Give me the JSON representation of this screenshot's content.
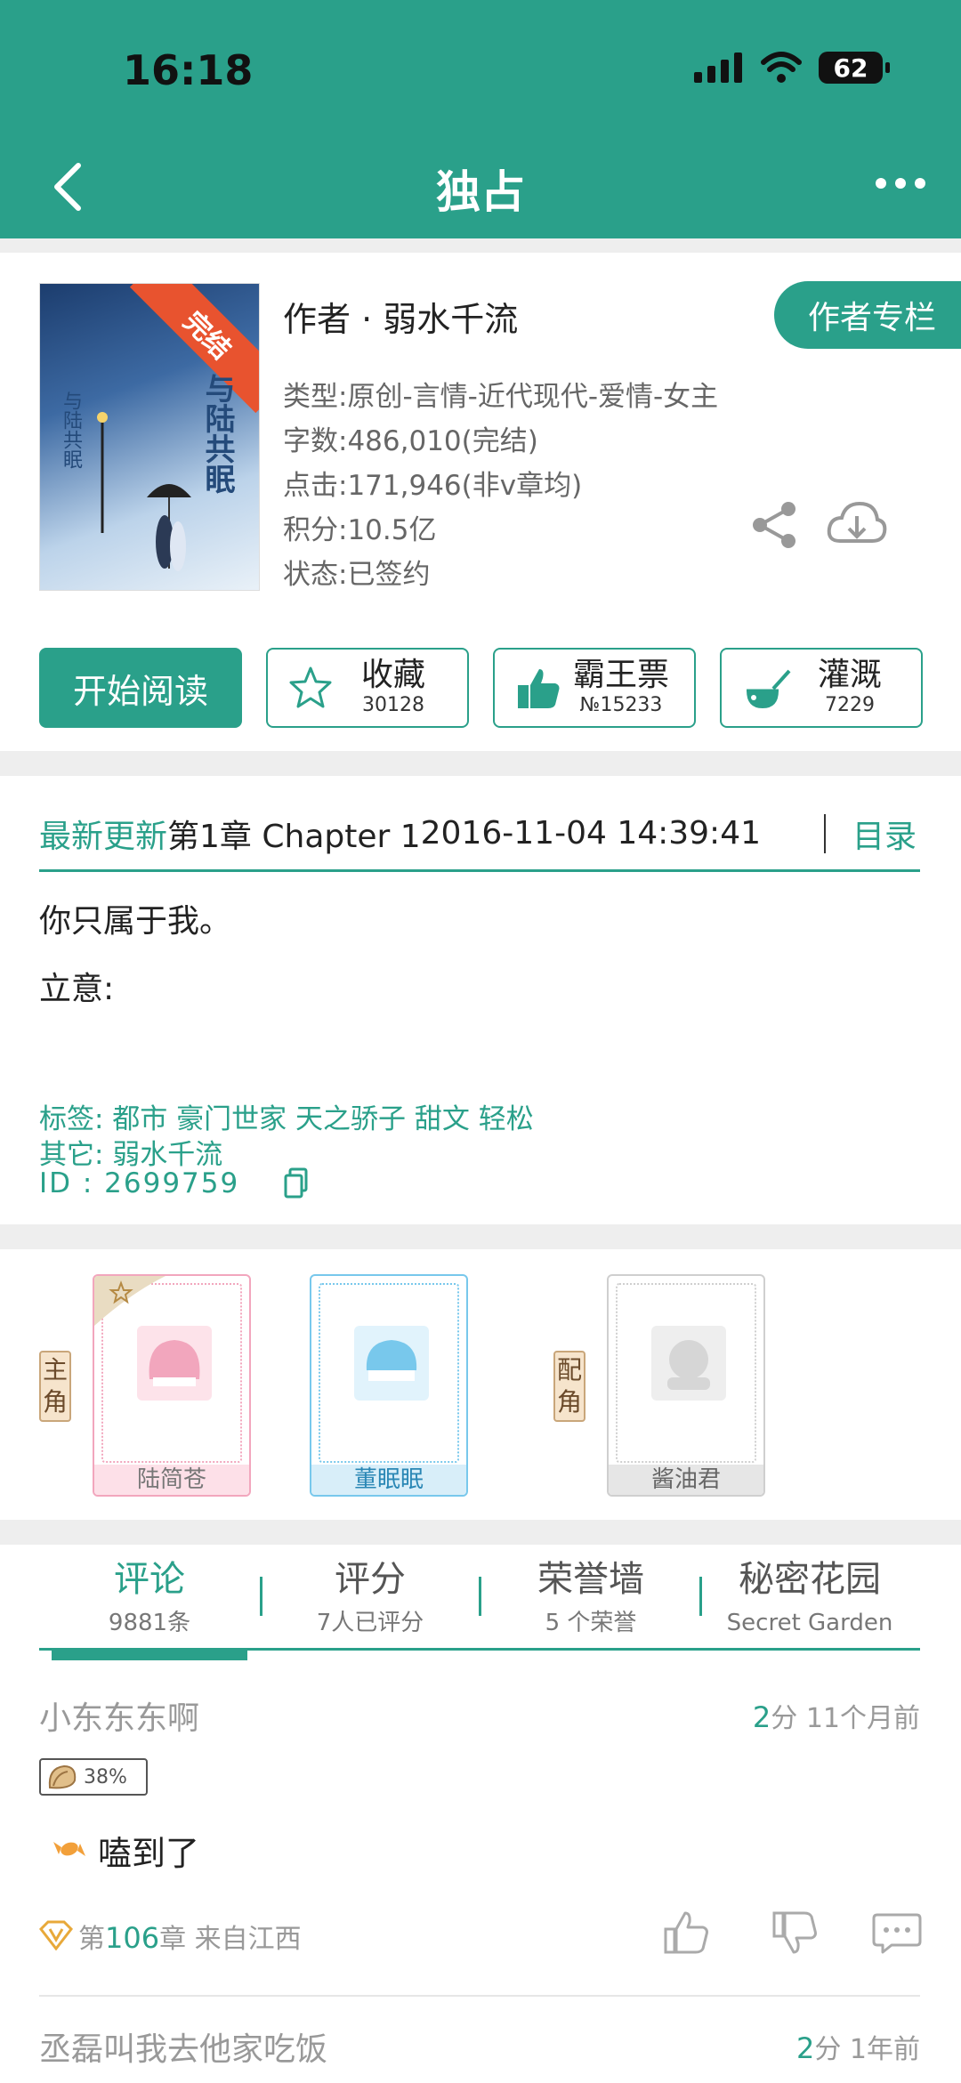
{
  "status_bar": {
    "time": "16:18",
    "battery": "62"
  },
  "nav": {
    "title": "独占"
  },
  "book": {
    "ribbon": "完结",
    "cover_title": "与陆共眠",
    "author": "作者 · 弱水千流",
    "author_column_label": "作者专栏",
    "genre": "类型:原创-言情-近代现代-爱情-女主",
    "words": "字数:486,010(完结)",
    "clicks": "点击:171,946(非v章均)",
    "points": "积分:10.5亿",
    "status": "状态:已签约"
  },
  "actions": {
    "read_label": "开始阅读",
    "collect": {
      "label": "收藏",
      "count": "30128"
    },
    "vote": {
      "label": "霸王票",
      "count": "№15233"
    },
    "water": {
      "label": "灌溉",
      "count": "7229"
    }
  },
  "update": {
    "label": "最新更新",
    "chapter": "第1章 Chapter 1",
    "datetime": "2016-11-04 14:39:41",
    "toc_label": "目录"
  },
  "intro": {
    "line1": "你只属于我。",
    "line2": "立意:"
  },
  "tags": {
    "tags_line": "标签: 都市  豪门世家  天之骄子  甜文  轻松",
    "other_line": "其它: 弱水千流",
    "id_line": "ID  :  2699759"
  },
  "roles": {
    "main_badge": "主角",
    "support_badge": "配角",
    "characters": [
      {
        "name": "陆简苍",
        "color": "#f2a6bd"
      },
      {
        "name": "董眠眠",
        "color": "#78c8ec"
      },
      {
        "name": "酱油君",
        "color": "#c8c8c8"
      }
    ]
  },
  "tabs": [
    {
      "label": "评论",
      "sub": "9881条"
    },
    {
      "label": "评分",
      "sub": "7人已评分"
    },
    {
      "label": "荣誉墙",
      "sub": "5 个荣誉"
    },
    {
      "label": "秘密花园",
      "sub": "Secret Garden"
    }
  ],
  "comments": [
    {
      "user": "小东东东啊",
      "score": "2",
      "score_suffix": "分",
      "time": "11个月前",
      "badge_pct": "38%",
      "text": "嗑到了",
      "chapter_prefix": "第",
      "chapter_num": "106",
      "chapter_suffix": "章 来自江西"
    },
    {
      "user": "丞磊叫我去他家吃饭",
      "score": "2",
      "score_suffix": "分",
      "time": "1年前"
    }
  ],
  "colors": {
    "accent": "#2aa08a"
  }
}
